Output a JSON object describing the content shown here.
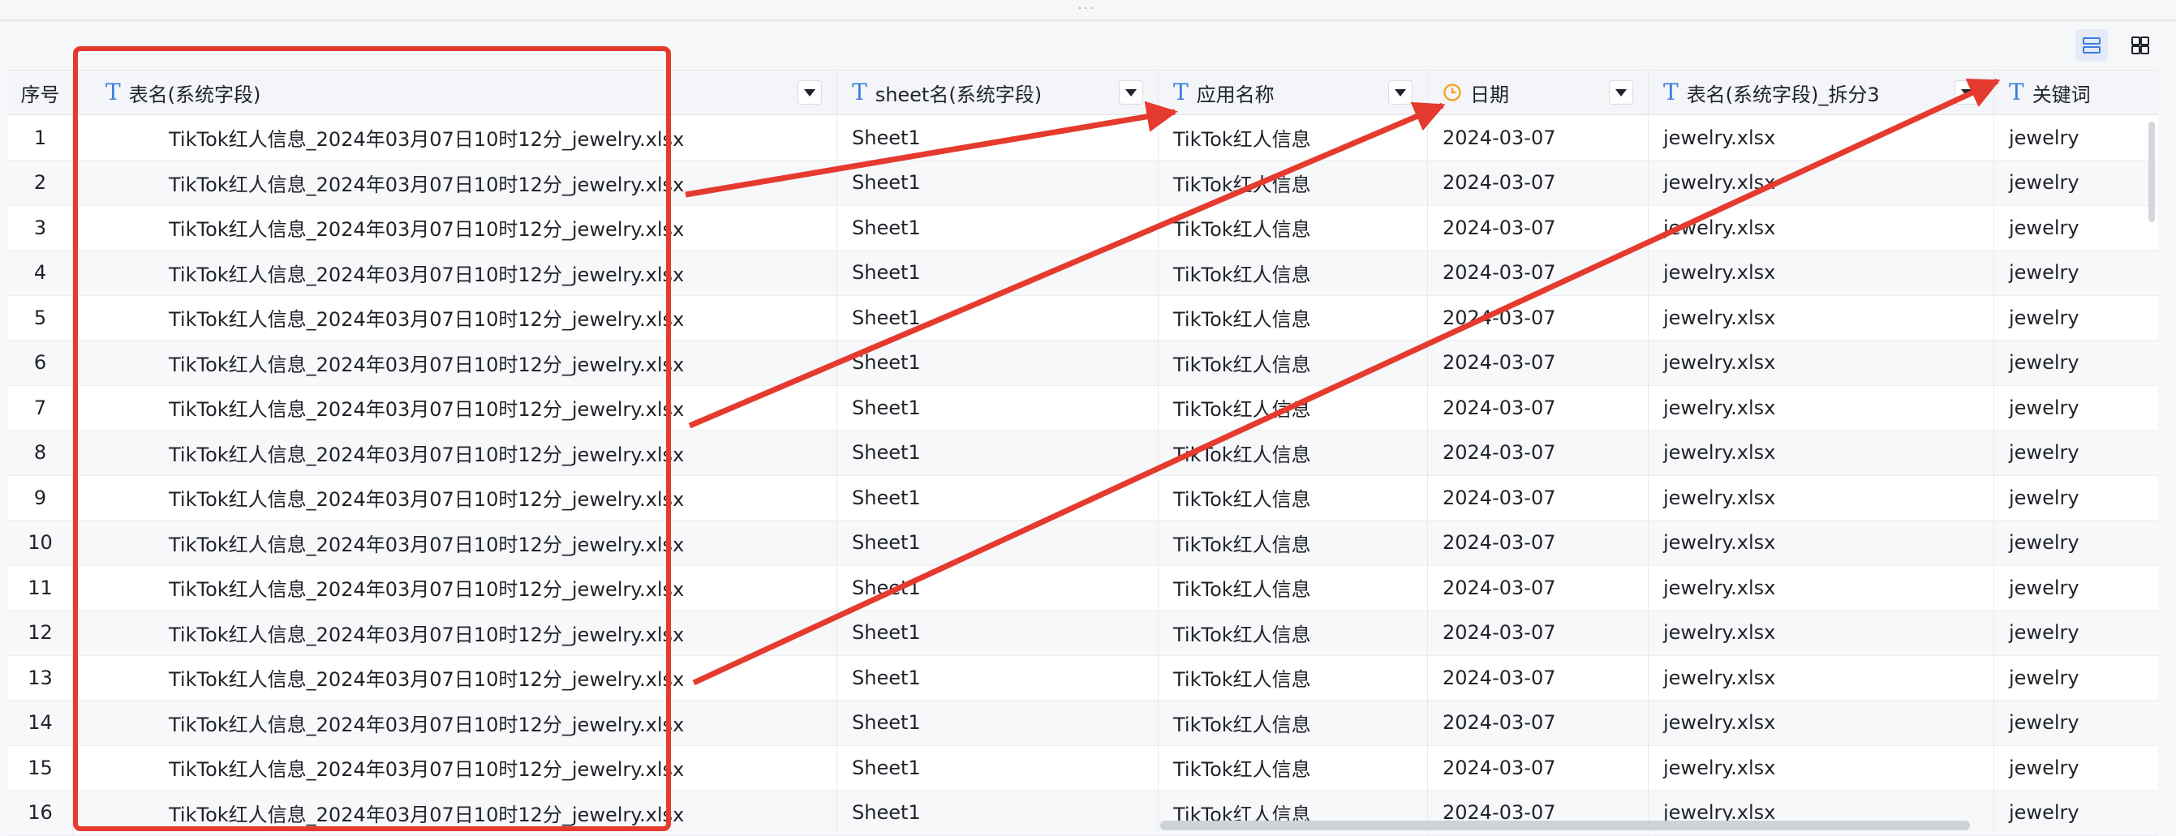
{
  "toolbar": {
    "list_view_icon": "list-view-icon",
    "grid_view_icon": "grid-view-icon"
  },
  "columns": [
    {
      "label": "序号",
      "type": "none"
    },
    {
      "label": "表名(系统字段)",
      "type": "text"
    },
    {
      "label": "sheet名(系统字段)",
      "type": "text"
    },
    {
      "label": "应用名称",
      "type": "text"
    },
    {
      "label": "日期",
      "type": "date"
    },
    {
      "label": "表名(系统字段)_拆分3",
      "type": "text"
    },
    {
      "label": "关键词",
      "type": "text"
    }
  ],
  "rows": [
    [
      "1",
      "TikTok红人信息_2024年03月07日10时12分_jewelry.xlsx",
      "Sheet1",
      "TikTok红人信息",
      "2024-03-07",
      "jewelry.xlsx",
      "jewelry"
    ],
    [
      "2",
      "TikTok红人信息_2024年03月07日10时12分_jewelry.xlsx",
      "Sheet1",
      "TikTok红人信息",
      "2024-03-07",
      "jewelry.xlsx",
      "jewelry"
    ],
    [
      "3",
      "TikTok红人信息_2024年03月07日10时12分_jewelry.xlsx",
      "Sheet1",
      "TikTok红人信息",
      "2024-03-07",
      "jewelry.xlsx",
      "jewelry"
    ],
    [
      "4",
      "TikTok红人信息_2024年03月07日10时12分_jewelry.xlsx",
      "Sheet1",
      "TikTok红人信息",
      "2024-03-07",
      "jewelry.xlsx",
      "jewelry"
    ],
    [
      "5",
      "TikTok红人信息_2024年03月07日10时12分_jewelry.xlsx",
      "Sheet1",
      "TikTok红人信息",
      "2024-03-07",
      "jewelry.xlsx",
      "jewelry"
    ],
    [
      "6",
      "TikTok红人信息_2024年03月07日10时12分_jewelry.xlsx",
      "Sheet1",
      "TikTok红人信息",
      "2024-03-07",
      "jewelry.xlsx",
      "jewelry"
    ],
    [
      "7",
      "TikTok红人信息_2024年03月07日10时12分_jewelry.xlsx",
      "Sheet1",
      "TikTok红人信息",
      "2024-03-07",
      "jewelry.xlsx",
      "jewelry"
    ],
    [
      "8",
      "TikTok红人信息_2024年03月07日10时12分_jewelry.xlsx",
      "Sheet1",
      "TikTok红人信息",
      "2024-03-07",
      "jewelry.xlsx",
      "jewelry"
    ],
    [
      "9",
      "TikTok红人信息_2024年03月07日10时12分_jewelry.xlsx",
      "Sheet1",
      "TikTok红人信息",
      "2024-03-07",
      "jewelry.xlsx",
      "jewelry"
    ],
    [
      "10",
      "TikTok红人信息_2024年03月07日10时12分_jewelry.xlsx",
      "Sheet1",
      "TikTok红人信息",
      "2024-03-07",
      "jewelry.xlsx",
      "jewelry"
    ],
    [
      "11",
      "TikTok红人信息_2024年03月07日10时12分_jewelry.xlsx",
      "Sheet1",
      "TikTok红人信息",
      "2024-03-07",
      "jewelry.xlsx",
      "jewelry"
    ],
    [
      "12",
      "TikTok红人信息_2024年03月07日10时12分_jewelry.xlsx",
      "Sheet1",
      "TikTok红人信息",
      "2024-03-07",
      "jewelry.xlsx",
      "jewelry"
    ],
    [
      "13",
      "TikTok红人信息_2024年03月07日10时12分_jewelry.xlsx",
      "Sheet1",
      "TikTok红人信息",
      "2024-03-07",
      "jewelry.xlsx",
      "jewelry"
    ],
    [
      "14",
      "TikTok红人信息_2024年03月07日10时12分_jewelry.xlsx",
      "Sheet1",
      "TikTok红人信息",
      "2024-03-07",
      "jewelry.xlsx",
      "jewelry"
    ],
    [
      "15",
      "TikTok红人信息_2024年03月07日10时12分_jewelry.xlsx",
      "Sheet1",
      "TikTok红人信息",
      "2024-03-07",
      "jewelry.xlsx",
      "jewelry"
    ],
    [
      "16",
      "TikTok红人信息_2024年03月07日10时12分_jewelry.xlsx",
      "Sheet1",
      "TikTok红人信息",
      "2024-03-07",
      "jewelry.xlsx",
      "jewelry"
    ]
  ],
  "colors": {
    "annotation": "#e53a2e",
    "text_type_icon": "#3a7de0",
    "date_type_icon": "#f5a623"
  }
}
